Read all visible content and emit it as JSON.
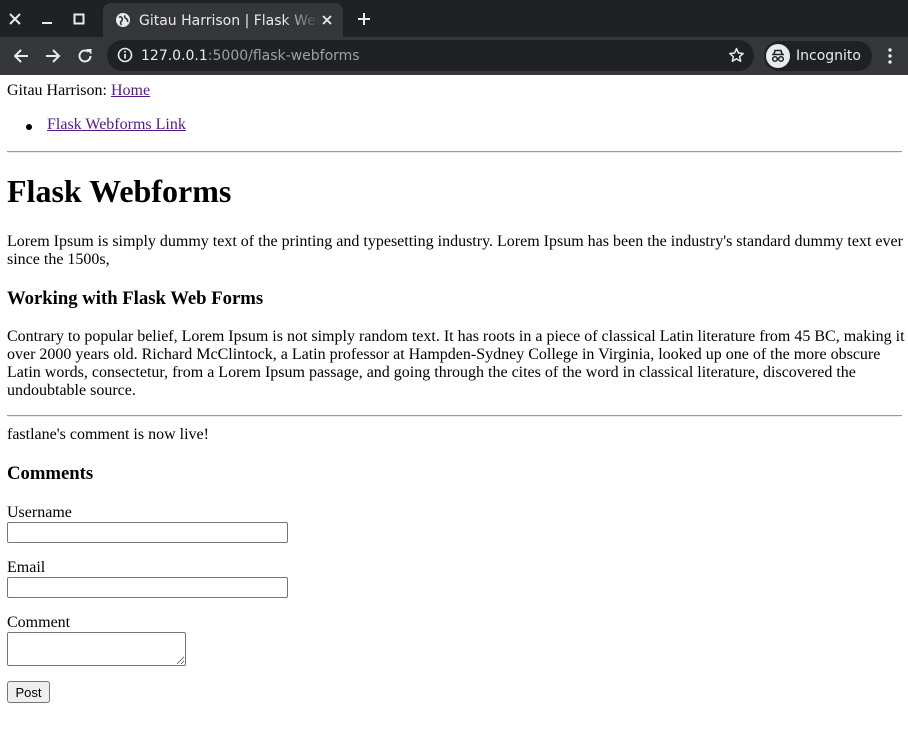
{
  "browser": {
    "tab_title": "Gitau Harrison | Flask Webforms",
    "url_host": "127.0.0.1",
    "url_path": ":5000/flask-webforms",
    "profile_label": "Incognito"
  },
  "header": {
    "brand_text": "Gitau Harrison: ",
    "home_link": "Home",
    "nav_link": "Flask Webforms Link"
  },
  "main": {
    "title": "Flask Webforms",
    "intro": "Lorem Ipsum is simply dummy text of the printing and typesetting industry. Lorem Ipsum has been the industry's standard dummy text ever since the 1500s,",
    "subheading": "Working with Flask Web Forms",
    "body": "Contrary to popular belief, Lorem Ipsum is not simply random text. It has roots in a piece of classical Latin literature from 45 BC, making it over 2000 years old. Richard McClintock, a Latin professor at Hampden-Sydney College in Virginia, looked up one of the more obscure Latin words, consectetur, from a Lorem Ipsum passage, and going through the cites of the word in classical literature, discovered the undoubtable source."
  },
  "flash_message": "fastlane's comment is now live!",
  "comments": {
    "heading": "Comments",
    "username_label": "Username",
    "username_value": "",
    "email_label": "Email",
    "email_value": "",
    "comment_label": "Comment",
    "comment_value": "",
    "submit_label": "Post"
  }
}
